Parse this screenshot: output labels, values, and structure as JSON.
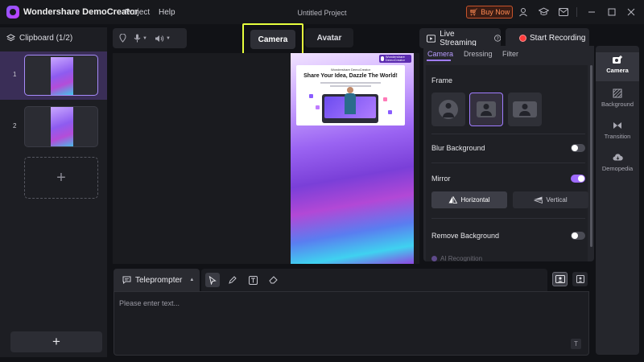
{
  "titlebar": {
    "app_name": "Wondershare DemoCreator",
    "menus": [
      "Project",
      "Help"
    ],
    "project_title": "Untitled Project",
    "buy_now": "Buy Now",
    "icons": [
      "cart-icon",
      "user-icon",
      "graduation-cap-icon",
      "mail-icon",
      "minimize-icon",
      "maximize-icon",
      "close-icon"
    ]
  },
  "clipboard": {
    "title": "Clipboard (1/2)",
    "items": [
      {
        "number": "1",
        "selected": true
      },
      {
        "number": "2",
        "selected": false
      }
    ],
    "add_symbol": "+",
    "add_button_symbol": "+"
  },
  "devices": {
    "icons": [
      "camera-pin-icon",
      "microphone-icon",
      "speaker-icon"
    ]
  },
  "mode_tabs": {
    "camera": "Camera",
    "avatar": "Avatar",
    "active": "Camera"
  },
  "preview": {
    "brand_small": "Wondershare DemoCreator",
    "banner_brand": "Wondershare DemoCreator",
    "banner_title": "Share Your Idea, Dazzle The World!"
  },
  "actions": {
    "live_streaming": "Live Streaming",
    "start_recording": "Start Recording"
  },
  "settings": {
    "tabs": [
      "Camera",
      "Dressing",
      "Filter"
    ],
    "active_tab": "Camera",
    "frame_label": "Frame",
    "frame_options": [
      "circle",
      "square",
      "rectangle"
    ],
    "frame_selected": "square",
    "blur_background": "Blur Background",
    "blur_on": false,
    "mirror": "Mirror",
    "mirror_on": true,
    "horizontal": "Horizontal",
    "vertical": "Vertical",
    "remove_background": "Remove Background",
    "remove_bg_on": false,
    "ai_recognition": "AI Recognition"
  },
  "rightbar": {
    "items": [
      {
        "label": "Camera",
        "icon": "camera-plus-icon",
        "active": true
      },
      {
        "label": "Background",
        "icon": "background-icon",
        "active": false
      },
      {
        "label": "Transition",
        "icon": "transition-icon",
        "active": false
      },
      {
        "label": "Demopedia",
        "icon": "cloud-icon",
        "active": false
      }
    ]
  },
  "teleprompter": {
    "label": "Teleprompter",
    "placeholder": "Please enter text...",
    "tools": [
      "select-icon",
      "pen-icon",
      "text-icon",
      "eraser-icon"
    ],
    "font_icon_label": "T"
  },
  "colors": {
    "accent": "#a07cff",
    "highlight": "#e7ff3d",
    "record": "#ff3b3b",
    "buy_now": "#ff8a52"
  }
}
